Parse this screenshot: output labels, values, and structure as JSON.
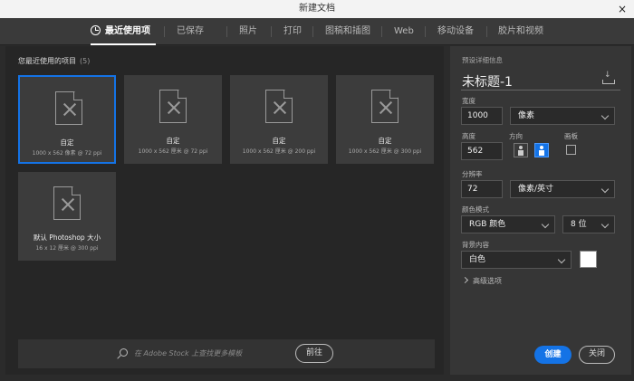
{
  "window": {
    "title": "新建文档",
    "close_glyph": "×"
  },
  "tabs": [
    {
      "label": "最近使用项",
      "active": true
    },
    {
      "label": "已保存"
    },
    {
      "label": "照片"
    },
    {
      "label": "打印"
    },
    {
      "label": "图稿和插图"
    },
    {
      "label": "Web"
    },
    {
      "label": "移动设备"
    },
    {
      "label": "胶片和视频"
    }
  ],
  "recent": {
    "title": "您最近使用的项目",
    "count": "(5)",
    "items": [
      {
        "name": "自定",
        "size": "1000 x 562 像素 @ 72 ppi",
        "selected": true
      },
      {
        "name": "自定",
        "size": "1000 x 562 厘米 @ 72 ppi"
      },
      {
        "name": "自定",
        "size": "1000 x 562 厘米 @ 200 ppi"
      },
      {
        "name": "自定",
        "size": "1000 x 562 厘米 @ 300 ppi"
      },
      {
        "name": "默认 Photoshop 大小",
        "size": "16 x 12 厘米 @ 300 ppi"
      }
    ]
  },
  "search": {
    "placeholder": "在 Adobe Stock 上查找更多模板",
    "go_label": "前往"
  },
  "details": {
    "heading": "预设详细信息",
    "doc_title": "未标题-1",
    "width_label": "宽度",
    "width_value": "1000",
    "width_unit": "像素",
    "height_label": "高度",
    "height_value": "562",
    "orientation_label": "方向",
    "artboard_label": "画板",
    "resolution_label": "分辨率",
    "resolution_value": "72",
    "resolution_unit": "像素/英寸",
    "color_mode_label": "颜色模式",
    "color_mode": "RGB 颜色",
    "bit_depth": "8 位",
    "background_label": "背景内容",
    "background": "白色",
    "background_color": "#ffffff",
    "advanced_label": "高级选项"
  },
  "buttons": {
    "create": "创建",
    "close": "关闭"
  },
  "colors": {
    "accent": "#1473e6"
  }
}
